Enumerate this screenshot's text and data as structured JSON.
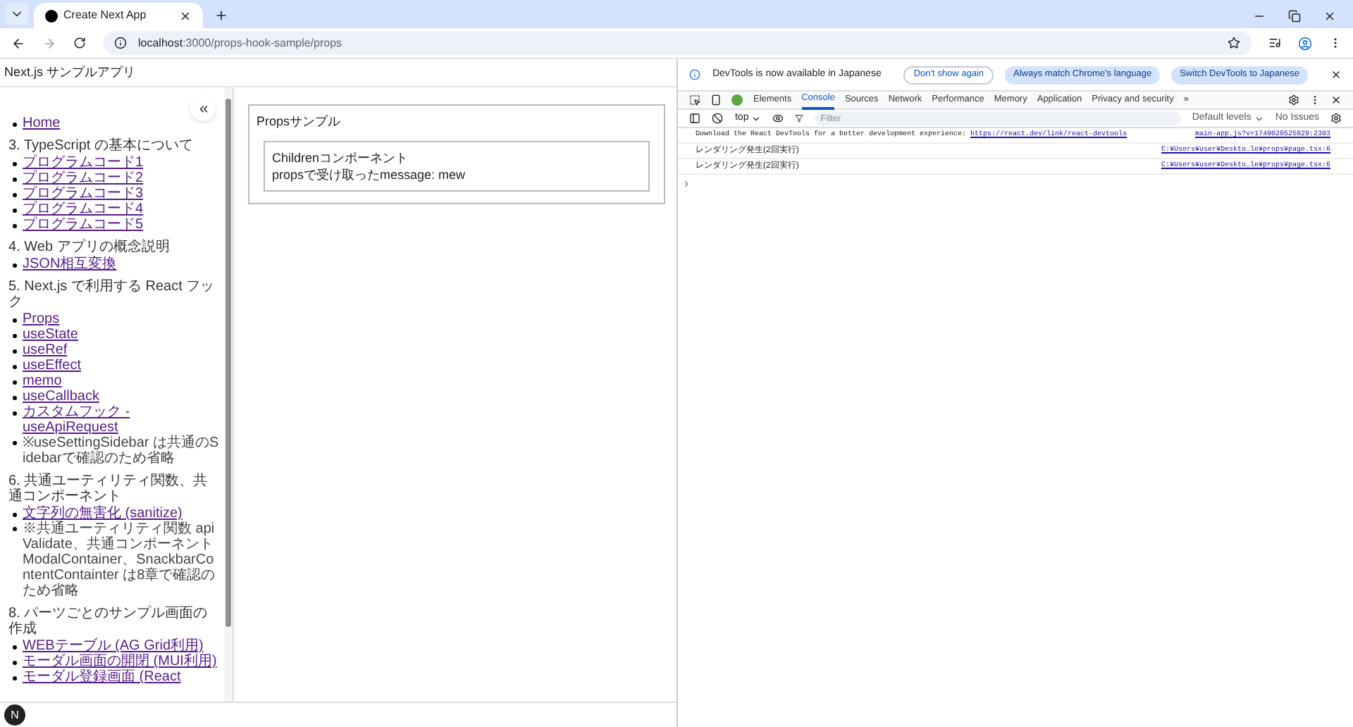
{
  "browser": {
    "tabs": [
      {
        "title": "Create Next App",
        "selected": true
      }
    ],
    "url_host": "localhost",
    "url_path": ":3000/props-hook-sample/props"
  },
  "page": {
    "app_title": "Next.js サンプルアプリ",
    "sidebar": {
      "sections": [
        {
          "items": [
            {
              "kind": "link",
              "label": "Home"
            }
          ]
        },
        {
          "heading": "3. TypeScript の基本について",
          "items": [
            {
              "kind": "link",
              "label": "プログラムコード1"
            },
            {
              "kind": "link",
              "label": "プログラムコード2"
            },
            {
              "kind": "link",
              "label": "プログラムコード3"
            },
            {
              "kind": "link",
              "label": "プログラムコード4"
            },
            {
              "kind": "link",
              "label": "プログラムコード5"
            }
          ]
        },
        {
          "heading": "4. Web アプリの概念説明",
          "items": [
            {
              "kind": "link",
              "label": "JSON相互変換"
            }
          ]
        },
        {
          "heading": "5. Next.js で利用する React フック",
          "items": [
            {
              "kind": "link",
              "label": "Props"
            },
            {
              "kind": "link",
              "label": "useState"
            },
            {
              "kind": "link",
              "label": "useRef"
            },
            {
              "kind": "link",
              "label": "useEffect"
            },
            {
              "kind": "link",
              "label": "memo"
            },
            {
              "kind": "link",
              "label": "useCallback"
            },
            {
              "kind": "link",
              "label": "カスタムフック - useApiRequest"
            },
            {
              "kind": "note",
              "label": "※useSettingSidebar は共通のSidebarで確認のため省略"
            }
          ]
        },
        {
          "heading": "6. 共通ユーティリティ関数、共通コンポーネント",
          "items": [
            {
              "kind": "link",
              "label": "文字列の無害化 (sanitize)"
            },
            {
              "kind": "note",
              "label": "※共通ユーティリティ関数 apiValidate、共通コンポーネント ModalContainer、SnackbarContentContainter は8章で確認のため省略"
            }
          ]
        },
        {
          "heading": "8. パーツごとのサンプル画面の作成",
          "items": [
            {
              "kind": "link",
              "label": "WEBテーブル (AG Grid利用)"
            },
            {
              "kind": "link",
              "label": "モーダル画面の開閉 (MUI利用)"
            },
            {
              "kind": "link",
              "label": "モーダル登録画面 (React"
            }
          ]
        }
      ]
    },
    "main": {
      "card_title": "Propsサンプル",
      "child_lines": [
        "Childrenコンポーネント",
        "propsで受け取ったmessage: mew"
      ]
    },
    "badge": "N"
  },
  "devtools": {
    "infobar": {
      "message": "DevTools is now available in Japanese",
      "buttons": [
        "Don't show again",
        "Always match Chrome's language",
        "Switch DevTools to Japanese"
      ]
    },
    "tabs": [
      {
        "label": "Elements",
        "selected": false
      },
      {
        "label": "Console",
        "selected": true
      },
      {
        "label": "Sources",
        "selected": false
      },
      {
        "label": "Network",
        "selected": false
      },
      {
        "label": "Performance",
        "selected": false
      },
      {
        "label": "Memory",
        "selected": false
      },
      {
        "label": "Application",
        "selected": false
      },
      {
        "label": "Privacy and security",
        "selected": false
      }
    ],
    "more_tabs": "»",
    "context": "top",
    "filter_placeholder": "Filter",
    "levels": "Default levels",
    "issues": "No Issues",
    "messages": [
      {
        "text": "Download the React DevTools for a better development experience: ",
        "link": "https://react.dev/link/react-devtools",
        "source": "main-app.js?v=1749020525029:2303"
      },
      {
        "text": "レンダリング発生(2回実行)",
        "source": "C:¥Users¥user¥Deskto…le¥props¥page.tsx:6"
      },
      {
        "text": "レンダリング発生(2回実行)",
        "source": "C:¥Users¥user¥Deskto…le¥props¥page.tsx:6"
      }
    ],
    "prompt": "›"
  }
}
